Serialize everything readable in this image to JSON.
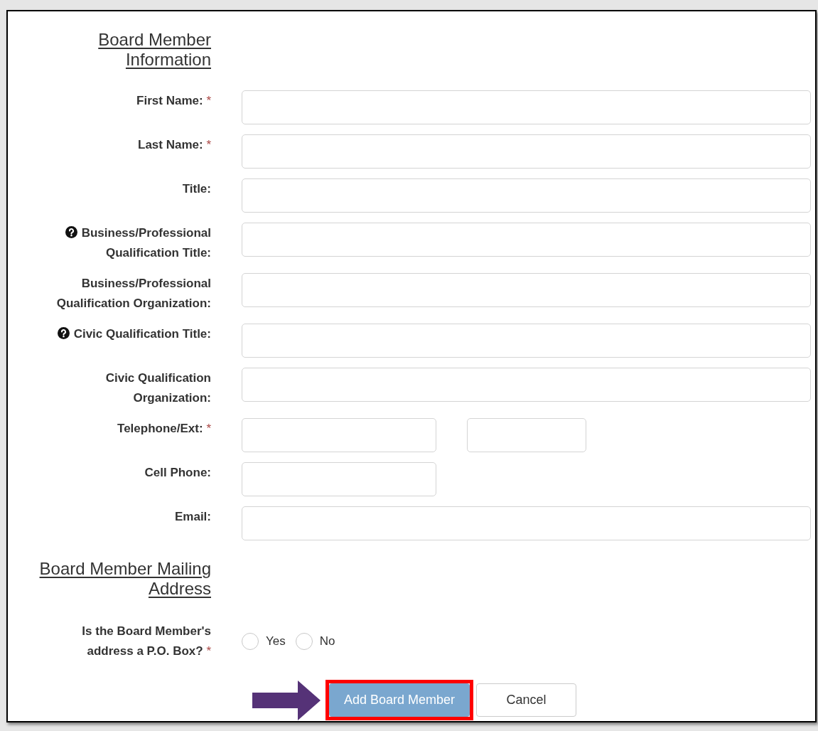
{
  "required_mark": "*",
  "sections": [
    {
      "heading": "Board Member Information",
      "fields": [
        {
          "label": "First Name:",
          "required": true,
          "help": false,
          "kind": "text"
        },
        {
          "label": "Last Name:",
          "required": true,
          "help": false,
          "kind": "text"
        },
        {
          "label": "Title:",
          "required": false,
          "help": false,
          "kind": "text"
        },
        {
          "label": "Business/Professional Qualification Title:",
          "required": false,
          "help": true,
          "kind": "text"
        },
        {
          "label": "Business/Professional Qualification Organization:",
          "required": false,
          "help": false,
          "kind": "text"
        },
        {
          "label": "Civic Qualification Title:",
          "required": false,
          "help": true,
          "kind": "text"
        },
        {
          "label": "Civic Qualification Organization:",
          "required": false,
          "help": false,
          "kind": "text"
        },
        {
          "label": "Telephone/Ext:",
          "required": true,
          "help": false,
          "kind": "phone"
        },
        {
          "label": "Cell Phone:",
          "required": false,
          "help": false,
          "kind": "short"
        },
        {
          "label": "Email:",
          "required": false,
          "help": false,
          "kind": "text"
        }
      ]
    },
    {
      "heading": "Board Member Mailing Address",
      "fields": [
        {
          "label": "Is the Board Member's address a P.O. Box?",
          "required": true,
          "help": false,
          "kind": "radio",
          "options": [
            {
              "label": "Yes",
              "selected": false
            },
            {
              "label": "No",
              "selected": false
            }
          ]
        }
      ]
    }
  ],
  "buttons": [
    {
      "label": "Add Board Member",
      "kind": "primary",
      "highlighted": true
    },
    {
      "label": "Cancel",
      "kind": "secondary",
      "highlighted": false
    }
  ],
  "pointer_arrow": true
}
